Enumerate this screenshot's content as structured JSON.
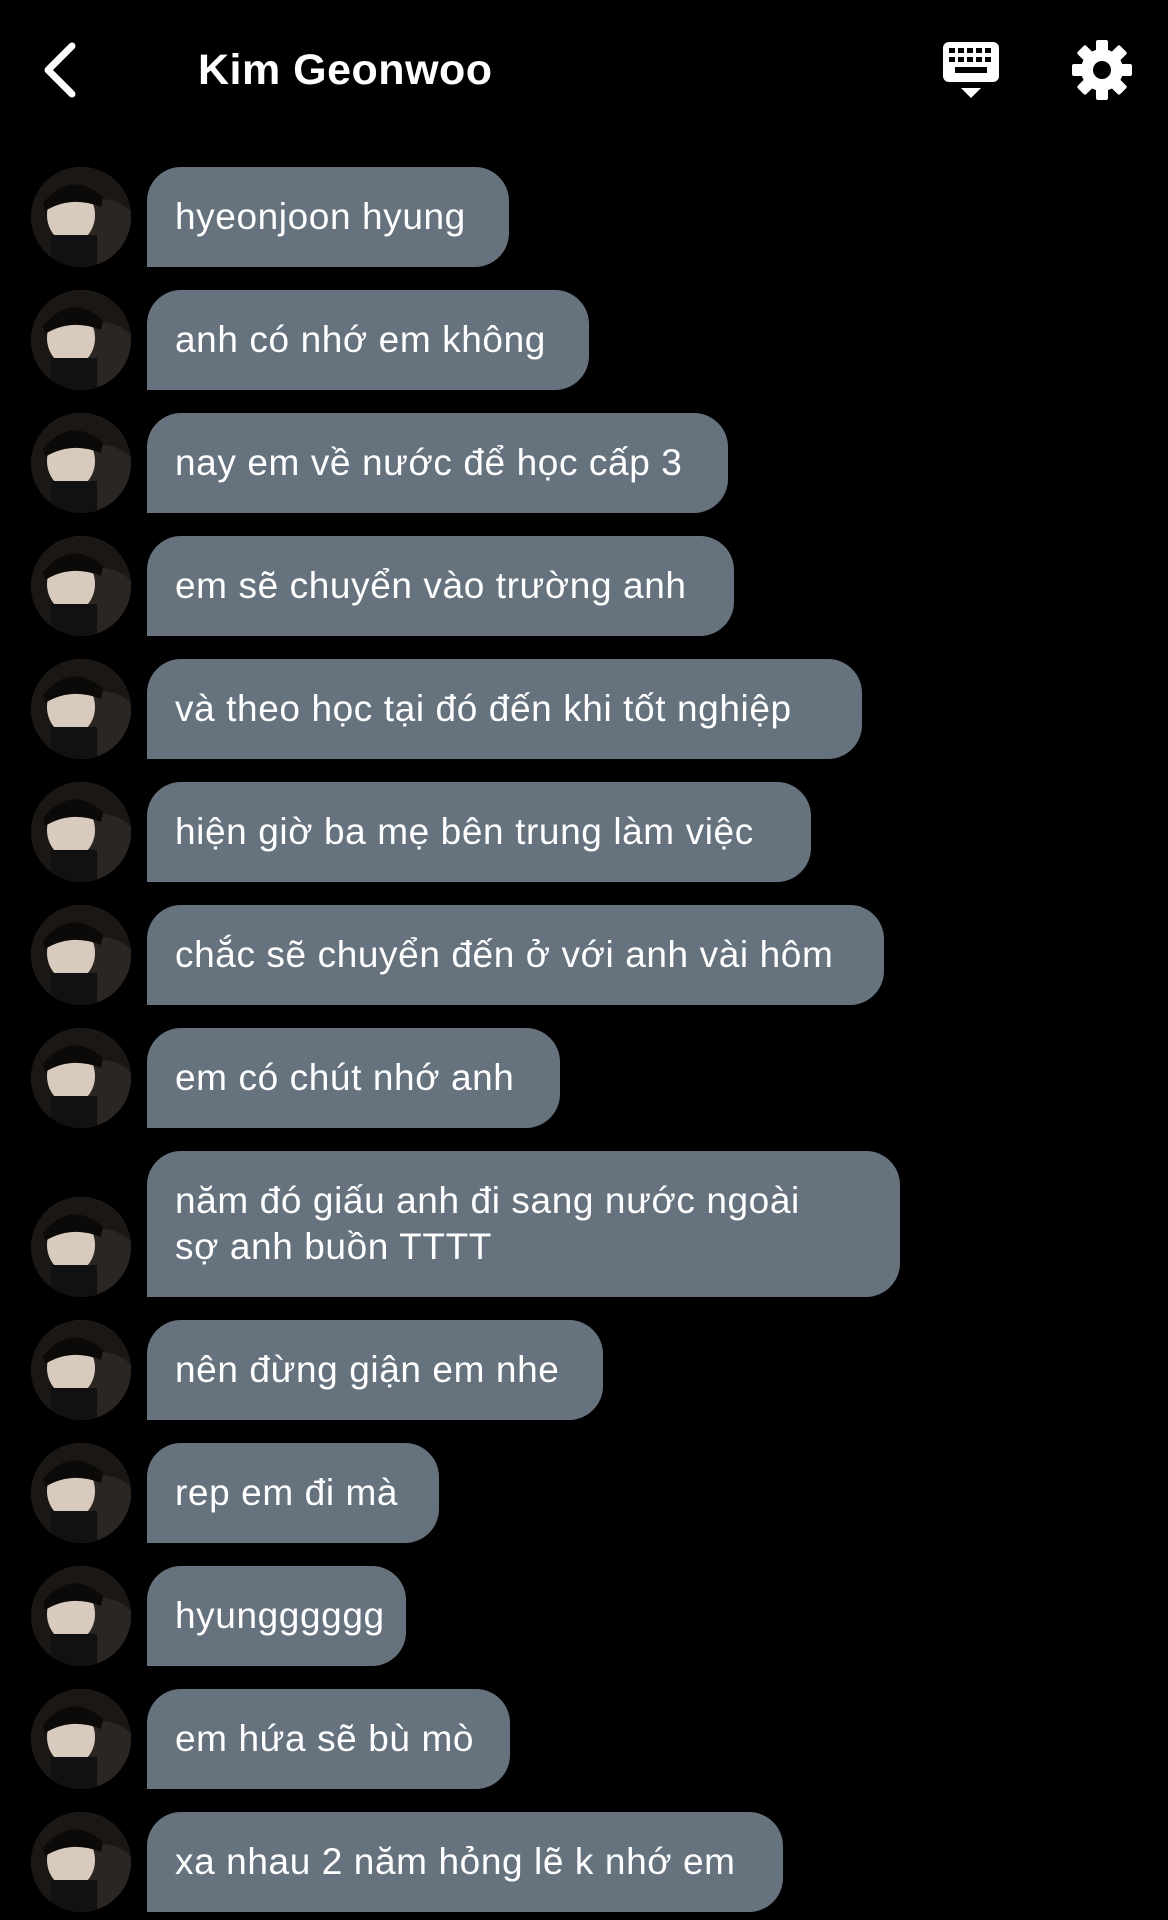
{
  "header": {
    "title": "Kim Geonwoo",
    "back_icon": "chevron-left-icon",
    "keyboard_icon": "keyboard-icon",
    "settings_icon": "gear-icon"
  },
  "colors": {
    "background": "#000000",
    "bubble": "#67727f",
    "text": "#ffffff"
  },
  "messages": [
    {
      "lines": [
        "hyeonjoon hyung"
      ]
    },
    {
      "lines": [
        "anh có nhớ em không"
      ]
    },
    {
      "lines": [
        "nay em về nước để học cấp 3"
      ]
    },
    {
      "lines": [
        "em sẽ chuyển vào trường anh"
      ]
    },
    {
      "lines": [
        "và theo học tại đó đến khi tốt nghiệp"
      ]
    },
    {
      "lines": [
        "hiện giờ ba mẹ bên trung làm việc"
      ]
    },
    {
      "lines": [
        "chắc sẽ chuyển đến ở với anh vài hôm"
      ]
    },
    {
      "lines": [
        "em có chút nhớ anh"
      ]
    },
    {
      "lines": [
        "năm đó giấu anh đi sang nước ngoài",
        "sợ anh buồn TTTT"
      ]
    },
    {
      "lines": [
        "nên đừng giận em nhe"
      ]
    },
    {
      "lines": [
        "rep em đi mà"
      ]
    },
    {
      "lines": [
        "hyungggggg"
      ]
    },
    {
      "lines": [
        "em hứa sẽ bù mò"
      ]
    },
    {
      "lines": [
        "xa nhau 2 năm hỏng lẽ k nhớ em"
      ]
    }
  ]
}
